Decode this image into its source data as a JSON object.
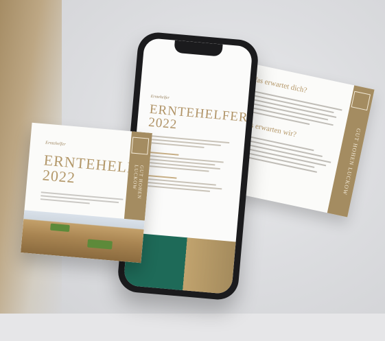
{
  "phone_card": {
    "subtitle": "Erntehelfer",
    "title_line1": "ERNTEHELFER",
    "title_line2": "2022"
  },
  "left_card": {
    "subtitle": "Erntehelfer",
    "title_line1": "ERNTEHELFER",
    "title_line2": "2022",
    "side_text": "GUT HOHEN LUCKOW"
  },
  "right_card": {
    "heading1": "Was erwartet dich?",
    "heading2": "Was erwarten wir?",
    "side_text": "GUT HOHEN LUCKOW"
  },
  "colors": {
    "gold": "#b3986a",
    "green": "#1e6a58"
  }
}
